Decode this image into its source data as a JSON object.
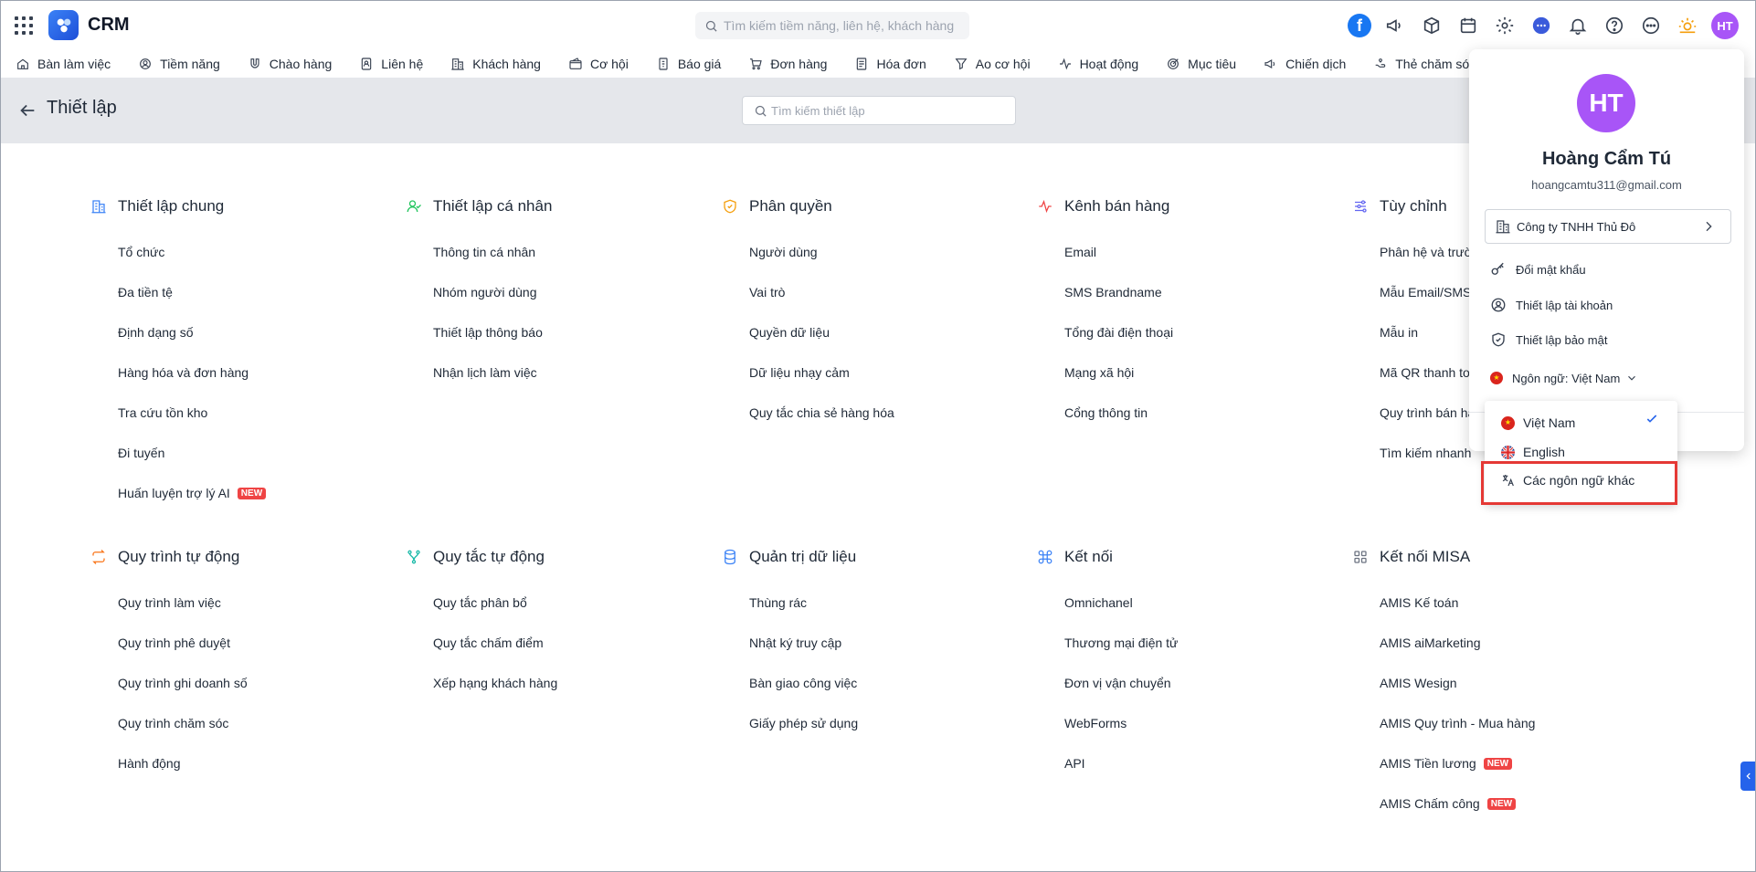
{
  "app": {
    "title": "CRM"
  },
  "top_search": {
    "placeholder": "Tìm kiếm tiềm năng, liên hệ, khách hàng"
  },
  "user": {
    "initials": "HT"
  },
  "nav": [
    {
      "label": "Bàn làm việc",
      "icon": "home-icon"
    },
    {
      "label": "Tiềm năng",
      "icon": "lead-icon"
    },
    {
      "label": "Chào hàng",
      "icon": "magnet-icon"
    },
    {
      "label": "Liên hệ",
      "icon": "contact-icon"
    },
    {
      "label": "Khách hàng",
      "icon": "building-icon"
    },
    {
      "label": "Cơ hội",
      "icon": "wallet-icon"
    },
    {
      "label": "Báo giá",
      "icon": "quote-icon"
    },
    {
      "label": "Đơn hàng",
      "icon": "cart-icon"
    },
    {
      "label": "Hóa đơn",
      "icon": "invoice-icon"
    },
    {
      "label": "Ao cơ hội",
      "icon": "funnel-icon"
    },
    {
      "label": "Hoạt động",
      "icon": "activity-icon"
    },
    {
      "label": "Mục tiêu",
      "icon": "target-icon"
    },
    {
      "label": "Chiến dịch",
      "icon": "megaphone-icon"
    },
    {
      "label": "Thẻ chăm sóc",
      "icon": "care-icon"
    }
  ],
  "settings": {
    "title": "Thiết lập",
    "search_placeholder": "Tìm kiếm thiết lập"
  },
  "sections": [
    {
      "title": "Thiết lập chung",
      "icon": "building-icon",
      "color": "#3b82f6",
      "items": [
        {
          "label": "Tổ chức"
        },
        {
          "label": "Đa tiền tệ"
        },
        {
          "label": "Định dạng số"
        },
        {
          "label": "Hàng hóa và đơn hàng"
        },
        {
          "label": "Tra cứu tồn kho"
        },
        {
          "label": "Đi tuyến"
        },
        {
          "label": "Huấn luyện trợ lý AI",
          "badge": "NEW"
        }
      ]
    },
    {
      "title": "Thiết lập cá nhân",
      "icon": "user-check-icon",
      "color": "#22c55e",
      "items": [
        {
          "label": "Thông tin cá nhân"
        },
        {
          "label": "Nhóm người dùng"
        },
        {
          "label": "Thiết lập thông báo"
        },
        {
          "label": "Nhận lịch làm việc"
        }
      ]
    },
    {
      "title": "Phân quyền",
      "icon": "shield-check-icon",
      "color": "#f59e0b",
      "items": [
        {
          "label": "Người dùng"
        },
        {
          "label": "Vai trò"
        },
        {
          "label": "Quyền dữ liệu"
        },
        {
          "label": "Dữ liệu nhạy cảm"
        },
        {
          "label": "Quy tắc chia sẻ hàng hóa"
        }
      ]
    },
    {
      "title": "Kênh bán hàng",
      "icon": "pulse-icon",
      "color": "#ef4444",
      "items": [
        {
          "label": "Email"
        },
        {
          "label": "SMS Brandname"
        },
        {
          "label": "Tổng đài điện thoại"
        },
        {
          "label": "Mạng xã hội"
        },
        {
          "label": "Cổng thông tin"
        }
      ]
    },
    {
      "title": "Tùy chỉnh",
      "icon": "sliders-icon",
      "color": "#6366f1",
      "items": [
        {
          "label": "Phân hệ và trường"
        },
        {
          "label": "Mẫu Email/SMS"
        },
        {
          "label": "Mẫu in"
        },
        {
          "label": "Mã QR thanh toán"
        },
        {
          "label": "Quy trình bán hàng"
        },
        {
          "label": "Tìm kiếm nhanh"
        }
      ]
    },
    {
      "title": "Quy trình tự động",
      "icon": "repeat-icon",
      "color": "#f97316",
      "items": [
        {
          "label": "Quy trình làm việc"
        },
        {
          "label": "Quy trình phê duyệt"
        },
        {
          "label": "Quy trình ghi doanh số"
        },
        {
          "label": "Quy trình chăm sóc"
        },
        {
          "label": "Hành động"
        }
      ]
    },
    {
      "title": "Quy tắc tự động",
      "icon": "fork-icon",
      "color": "#14b8a6",
      "items": [
        {
          "label": "Quy tắc phân bổ"
        },
        {
          "label": "Quy tắc chấm điểm"
        },
        {
          "label": "Xếp hạng khách hàng"
        }
      ]
    },
    {
      "title": "Quản trị dữ liệu",
      "icon": "database-icon",
      "color": "#3b82f6",
      "items": [
        {
          "label": "Thùng rác"
        },
        {
          "label": "Nhật ký truy cập"
        },
        {
          "label": "Bàn giao công việc"
        },
        {
          "label": "Giấy phép sử dụng"
        }
      ]
    },
    {
      "title": "Kết nối",
      "icon": "command-icon",
      "color": "#3b82f6",
      "items": [
        {
          "label": "Omnichanel"
        },
        {
          "label": "Thương mại điện tử"
        },
        {
          "label": "Đơn vị vận chuyển"
        },
        {
          "label": "WebForms"
        },
        {
          "label": "API"
        }
      ]
    },
    {
      "title": "Kết nối MISA",
      "icon": "grid-icon",
      "color": "#6b7280",
      "items": [
        {
          "label": "AMIS Kế toán"
        },
        {
          "label": "AMIS aiMarketing"
        },
        {
          "label": "AMIS Wesign"
        },
        {
          "label": "AMIS Quy trình - Mua hàng"
        },
        {
          "label": "AMIS Tiền lương",
          "badge": "NEW"
        },
        {
          "label": "AMIS Chấm công",
          "badge": "NEW"
        }
      ]
    }
  ],
  "profile": {
    "initials": "HT",
    "name": "Hoàng Cẩm Tú",
    "email": "hoangcamtu311@gmail.com",
    "company": "Công ty TNHH Thủ Đô",
    "change_password": "Đổi mật khẩu",
    "account_settings": "Thiết lập tài khoản",
    "security_settings": "Thiết lập bảo mật",
    "language_label": "Ngôn ngữ: Việt Nam"
  },
  "language_menu": {
    "options": [
      {
        "label": "Việt Nam",
        "selected": true
      },
      {
        "label": "English",
        "selected": false
      }
    ],
    "other": "Các ngôn ngữ khác"
  },
  "colors": {
    "accent": "#2563eb",
    "avatar": "#a855f7",
    "highlight": "#e53935",
    "badge": "#ef4444"
  }
}
